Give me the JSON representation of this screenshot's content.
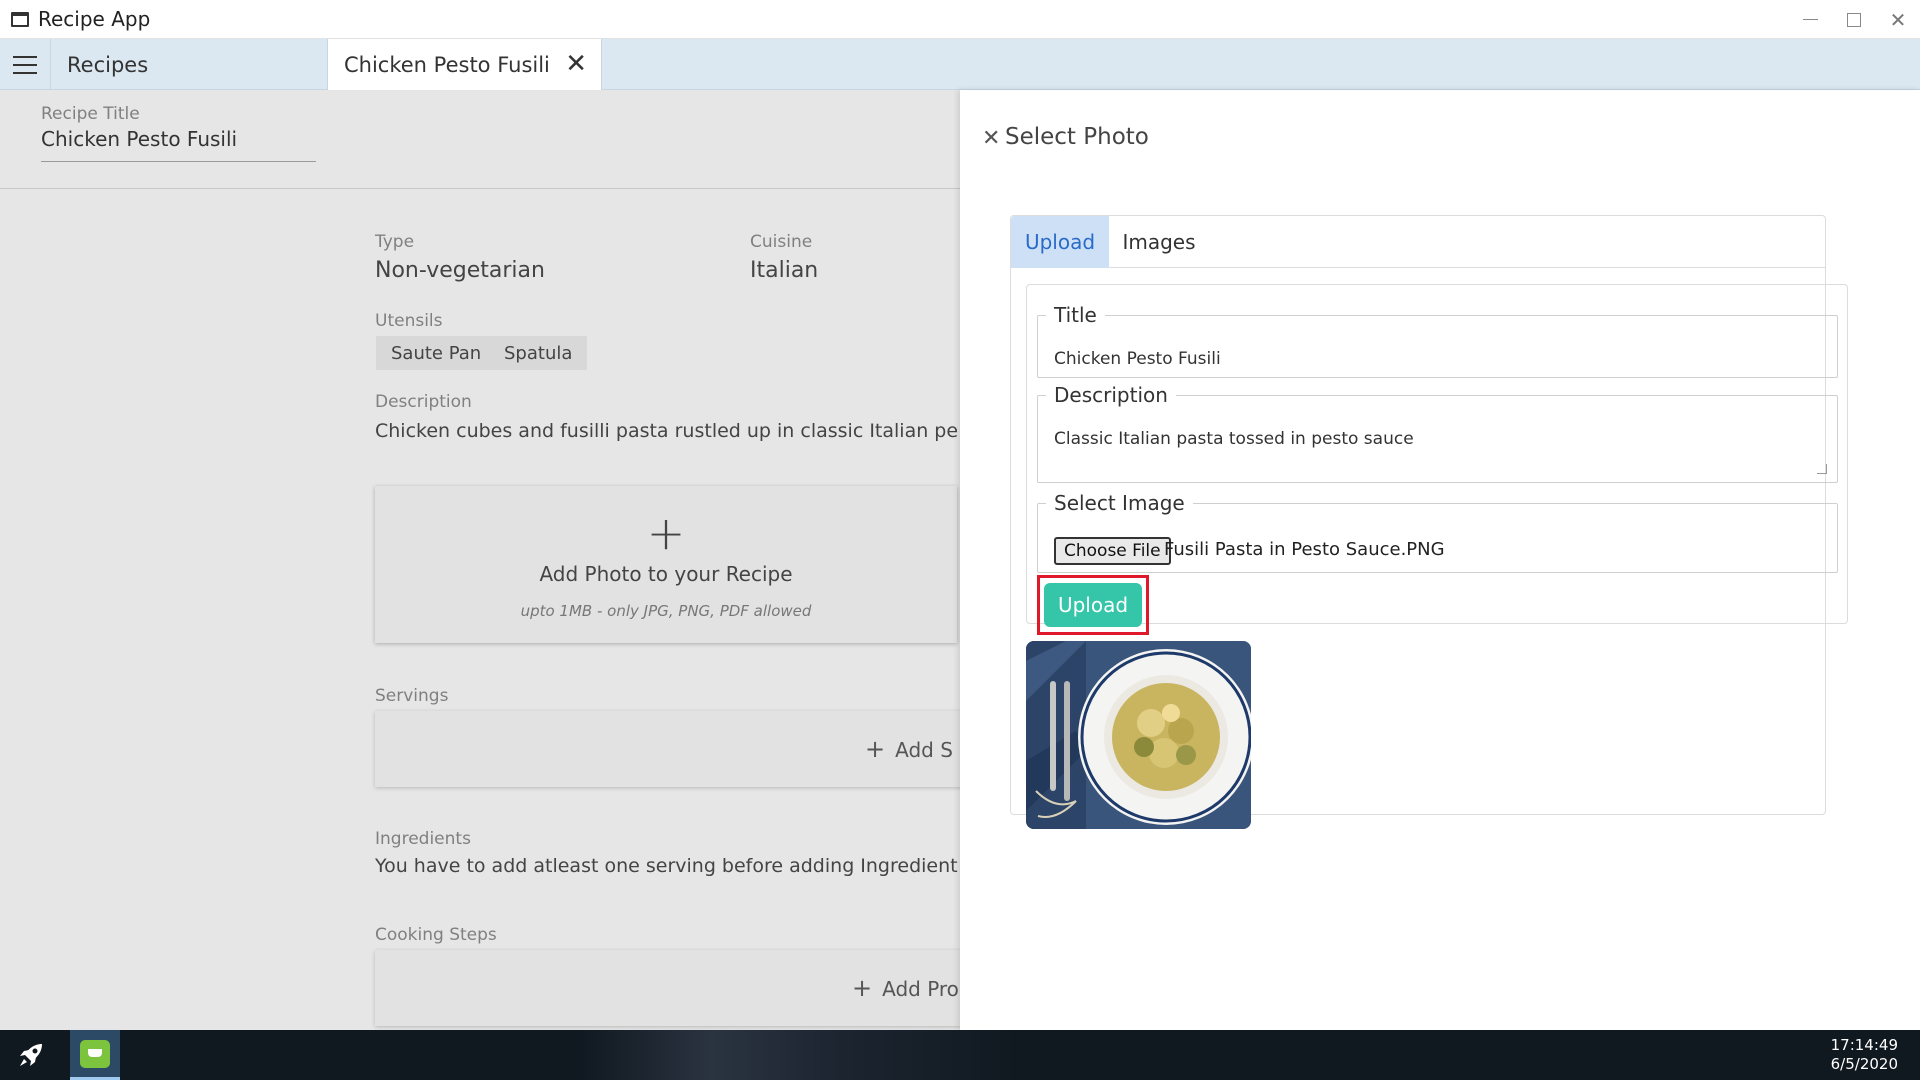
{
  "window": {
    "title": "Recipe App",
    "icons": [
      "window-icon",
      "minimize-icon",
      "maximize-icon",
      "close-icon"
    ]
  },
  "tabs": {
    "recipes": "Recipes",
    "active": "Chicken Pesto Fusili"
  },
  "recipe": {
    "title_label": "Recipe Title",
    "title_value": "Chicken Pesto Fusili",
    "type_label": "Type",
    "type_value": "Non-vegetarian",
    "cuisine_label": "Cuisine",
    "cuisine_value": "Italian",
    "utensils_label": "Utensils",
    "utensils": [
      "Saute Pan",
      "Spatula"
    ],
    "description_label": "Description",
    "description_value": "Chicken cubes and fusilli pasta rustled up in classic Italian pe",
    "add_photo_plus": "+",
    "add_photo_label": "Add Photo to your Recipe",
    "add_photo_hint": "upto 1MB - only JPG, PNG, PDF allowed",
    "servings_label": "Servings",
    "add_serving_plus": "+",
    "add_serving_label": "Add S",
    "ingredients_label": "Ingredients",
    "ingredients_message": "You have to add atleast one serving before adding Ingredient",
    "cooking_steps_label": "Cooking Steps",
    "add_step_plus": "+",
    "add_step_label": "Add Pro"
  },
  "select_photo": {
    "close_glyph": "✕",
    "heading": "Select Photo",
    "tab_upload": "Upload",
    "tab_images": "Images",
    "title_legend": "Title",
    "title_value": "Chicken Pesto Fusili",
    "description_legend": "Description",
    "description_value": "Classic Italian pasta tossed in pesto sauce",
    "image_legend": "Select Image",
    "choose_file_label": "Choose File",
    "file_name": "Fusili Pasta in Pesto Sauce.PNG",
    "upload_button": "Upload"
  },
  "taskbar": {
    "time": "17:14:49",
    "date": "6/5/2020"
  },
  "colors": {
    "accent_tab": "#cde0f5",
    "upload_button": "#35c5a8",
    "highlight": "#e0182c",
    "tabbar": "#dbe8f1"
  }
}
